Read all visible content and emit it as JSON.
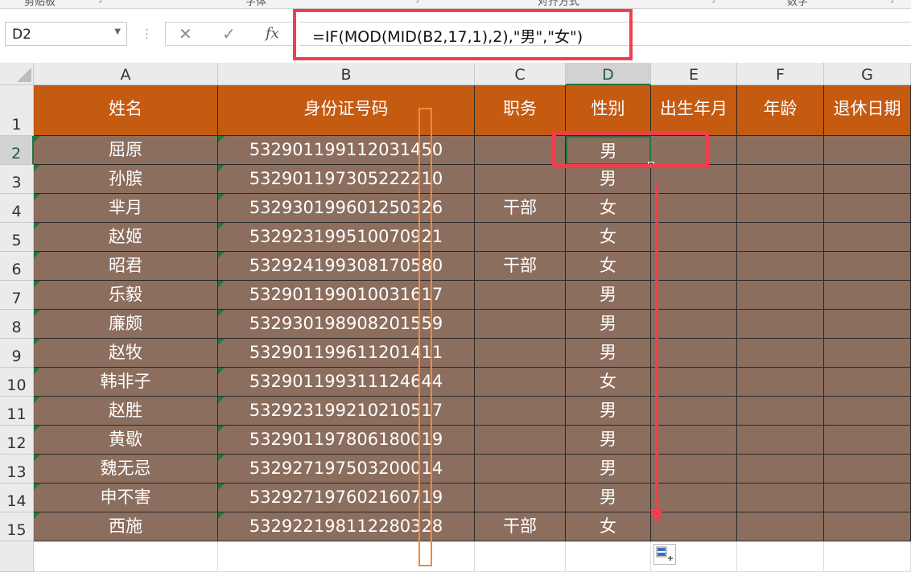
{
  "ribbon": {
    "groups": [
      {
        "label": "剪贴板"
      },
      {
        "label": "字体"
      },
      {
        "label": "对齐方式"
      },
      {
        "label": "数字"
      }
    ]
  },
  "name_box": {
    "value": "D2"
  },
  "formula_bar": {
    "cancel_icon": "close-icon",
    "enter_icon": "check-icon",
    "fx_label": "fx",
    "formula": "=IF(MOD(MID(B2,17,1),2),\"男\",\"女\")"
  },
  "sheet": {
    "columns": [
      "A",
      "B",
      "C",
      "D",
      "E",
      "F",
      "G"
    ],
    "selected_column": "D",
    "selected_row": "2",
    "header_row": {
      "number": "1",
      "cells": [
        "姓名",
        "身份证号码",
        "职务",
        "性别",
        "出生年月",
        "年龄",
        "退休日期"
      ]
    },
    "rows": [
      {
        "number": "2",
        "name": "屈原",
        "id": "532901199112031450",
        "title": "",
        "gender": "男"
      },
      {
        "number": "3",
        "name": "孙膑",
        "id": "532901197305222210",
        "title": "",
        "gender": "男"
      },
      {
        "number": "4",
        "name": "芈月",
        "id": "532930199601250326",
        "title": "干部",
        "gender": "女"
      },
      {
        "number": "5",
        "name": "赵姬",
        "id": "532923199510070921",
        "title": "",
        "gender": "女"
      },
      {
        "number": "6",
        "name": "昭君",
        "id": "532924199308170580",
        "title": "干部",
        "gender": "女"
      },
      {
        "number": "7",
        "name": "乐毅",
        "id": "532901199010031617",
        "title": "",
        "gender": "男"
      },
      {
        "number": "8",
        "name": "廉颇",
        "id": "532930198908201559",
        "title": "",
        "gender": "男"
      },
      {
        "number": "9",
        "name": "赵牧",
        "id": "532901199611201411",
        "title": "",
        "gender": "男"
      },
      {
        "number": "10",
        "name": "韩非子",
        "id": "532901199311124644",
        "title": "",
        "gender": "女"
      },
      {
        "number": "11",
        "name": "赵胜",
        "id": "532923199210210517",
        "title": "",
        "gender": "男"
      },
      {
        "number": "12",
        "name": "黄歇",
        "id": "532901197806180019",
        "title": "",
        "gender": "男"
      },
      {
        "number": "13",
        "name": "魏无忌",
        "id": "532927197503200014",
        "title": "",
        "gender": "男"
      },
      {
        "number": "14",
        "name": "申不害",
        "id": "532927197602160719",
        "title": "",
        "gender": "男"
      },
      {
        "number": "15",
        "name": "西施",
        "id": "532922198112280328",
        "title": "干部",
        "gender": "女"
      }
    ]
  },
  "colors": {
    "header_fill": "#c55a11",
    "body_fill": "#8c6e5e",
    "highlight_red": "#f23d4b",
    "highlight_orange": "#f08a3c",
    "selection_green": "#217346"
  },
  "icons": {
    "autofill_options": "autofill-options-icon",
    "select_all": "select-all-icon"
  }
}
